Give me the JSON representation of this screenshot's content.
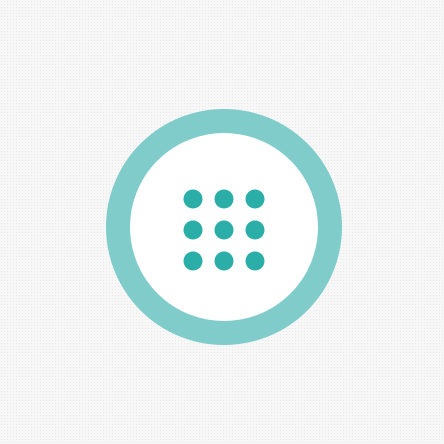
{
  "launcher": {
    "icon": "apps-grid-icon",
    "ring_color": "#7fcccb",
    "dot_color": "#2aaea7",
    "background_color": "#ffffff",
    "grid_rows": 3,
    "grid_cols": 3
  }
}
